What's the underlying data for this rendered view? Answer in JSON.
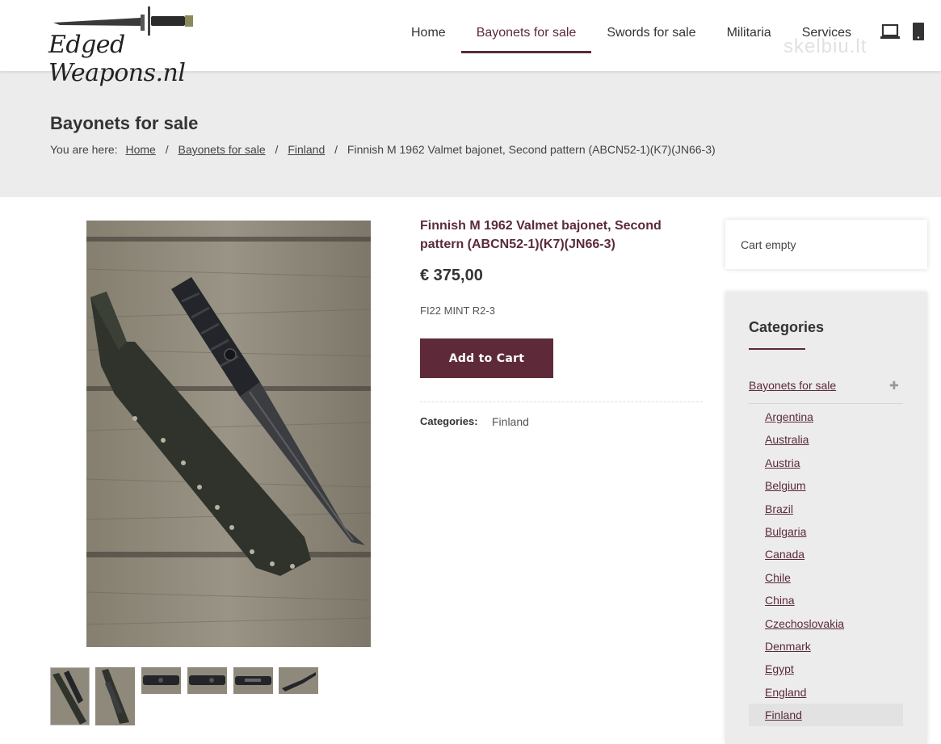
{
  "header": {
    "logo_text": "Edged Weapons.nl",
    "nav": [
      {
        "label": "Home",
        "active": false
      },
      {
        "label": "Bayonets for sale",
        "active": true
      },
      {
        "label": "Swords for sale",
        "active": false
      },
      {
        "label": "Militaria",
        "active": false
      },
      {
        "label": "Services",
        "active": false
      }
    ],
    "icons": [
      "laptop-icon",
      "tablet-icon"
    ],
    "watermark": "skelbiu.lt"
  },
  "page": {
    "title": "Bayonets for sale",
    "breadcrumb_prefix": "You are here:",
    "breadcrumb": [
      "Home",
      "Bayonets for sale",
      "Finland"
    ],
    "breadcrumb_current": "Finnish M 1962 Valmet bajonet, Second pattern (ABCN52-1)(K7)(JN66-3)"
  },
  "product": {
    "title": "Finnish M 1962 Valmet bajonet, Second pattern (ABCN52-1)(K7)(JN66-3)",
    "price": "€ 375,00",
    "sku": "FI22 MINT R2-3",
    "add_to_cart": "Add to Cart",
    "categories_label": "Categories:",
    "category": "Finland",
    "thumbnail_count": 6
  },
  "sidebar": {
    "cart_text": "Cart empty",
    "categories_title": "Categories",
    "parent_category": "Bayonets for sale",
    "toggle_icon": "plus-icon",
    "countries": [
      "Argentina",
      "Australia",
      "Austria",
      "Belgium",
      "Brazil",
      "Bulgaria",
      "Canada",
      "Chile",
      "China",
      "Czechoslovakia",
      "Denmark",
      "Egypt",
      "England",
      "Finland"
    ],
    "active_country": "Finland"
  },
  "colors": {
    "accent": "#5b2a3a",
    "button": "#5e2a39",
    "band": "#ececec"
  }
}
